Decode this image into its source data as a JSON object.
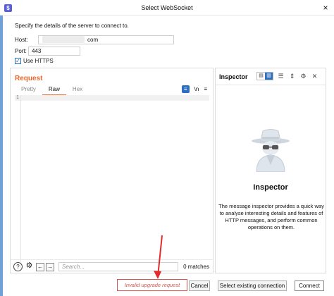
{
  "window": {
    "title": "Select WebSocket",
    "app_icon": "$",
    "close_icon": "×"
  },
  "form": {
    "description": "Specify the details of the server to connect to.",
    "host_label": "Host:",
    "host_value": "com",
    "port_label": "Port:",
    "port_value": "443",
    "https_label": "Use HTTPS",
    "https_checked": true
  },
  "request": {
    "title": "Request",
    "tabs": [
      "Pretty",
      "Raw",
      "Hex"
    ],
    "active_tab": "Raw",
    "tool_pretty_icon": "≡",
    "tool_newline": "\\n",
    "tool_menu": "≡",
    "line_number": "1"
  },
  "bottom_bar": {
    "help_icon": "?",
    "settings_icon": "⚙",
    "back_icon": "←",
    "forward_icon": "→",
    "search_placeholder": "Search...",
    "matches": "0 matches"
  },
  "inspector": {
    "title": "Inspector",
    "heading": "Inspector",
    "description": "The message inspector provides a quick way to analyse interesting details and features of HTTP messages, and perform common operations on them."
  },
  "footer": {
    "error": "Invalid upgrade request",
    "cancel": "Cancel",
    "select_existing": "Select existing connection",
    "connect": "Connect"
  },
  "colors": {
    "accent": "#e8682e",
    "primary_blue": "#2d6fc1",
    "error": "#d9534f"
  }
}
